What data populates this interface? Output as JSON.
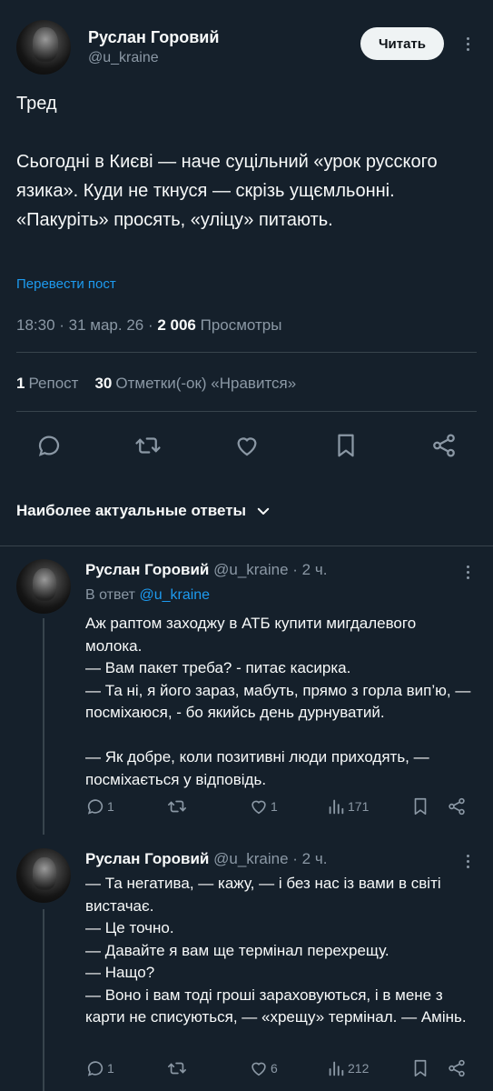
{
  "post": {
    "author_name": "Руслан Горовий",
    "author_handle": "@u_kraine",
    "follow_label": "Читать",
    "text": "Тред\n\nСьогодні в Києві — наче суцільний «урок русского язика». Куди не ткнуся — скрізь ущємльонні.\n«Пакуріть» просять, «уліцу» питають.",
    "translate_label": "Перевести пост",
    "time": "18:30 · 31 мар. 26 · ",
    "views_count": "2 006",
    "views_label": " Просмотры",
    "reposts_count": "1",
    "reposts_label": "Репост",
    "likes_count": "30",
    "likes_label": "Отметки(-ок) «Нравится»"
  },
  "icons": {
    "reply": "speech-bubble-icon",
    "repost": "repost-arrows-icon",
    "like": "heart-icon",
    "bookmark": "bookmark-icon",
    "share": "share-icon",
    "views": "bar-chart-icon"
  },
  "replies_header": "Наиболее актуальные ответы",
  "replies": [
    {
      "author_name": "Руслан Горовий",
      "author_handle": "@u_kraine",
      "time": " · 2 ч.",
      "reply_to_prefix": "В ответ ",
      "reply_to_handle": "@u_kraine",
      "text": "Аж раптом заходжу в АТБ купити мигдалевого молока.\n— Вам пакет треба? - питає касирка.\n— Та ні, я його зараз, мабуть, прямо з горла вип’ю, — посміхаюся, - бо якийсь день дурнуватий.\n\n— Як добре, коли позитивні люди приходять, — посміхається у відповідь.",
      "replies": "1",
      "reposts": "",
      "likes": "1",
      "views": "171"
    },
    {
      "author_name": "Руслан Горовий",
      "author_handle": "@u_kraine",
      "time": " · 2 ч.",
      "text": "— Та негатива, — кажу, — і без нас із вами в світі вистачає.\n— Це точно.\n— Давайте я вам ще термінал перехрещу.\n— Нащо?\n— Воно і вам тоді гроші зараховуються, і в мене з карти не списуються, — «хрещу» термінал. — Амінь.",
      "replies": "1",
      "reposts": "",
      "likes": "6",
      "views": "212"
    }
  ],
  "colors": {
    "background": "#15202b",
    "text": "#f7f9f9",
    "muted": "#8b98a5",
    "link": "#1d9bf0",
    "divider": "#38444d"
  }
}
